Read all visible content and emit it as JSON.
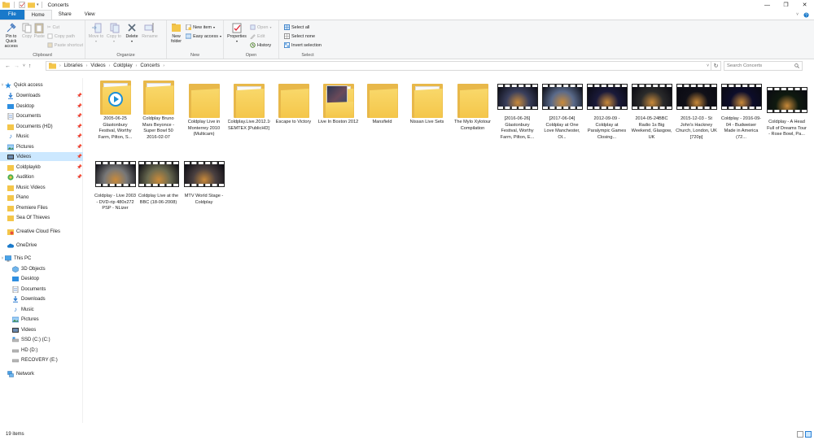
{
  "window": {
    "title": "Concerts",
    "controls": [
      "—",
      "❐",
      "✕"
    ]
  },
  "tabs": [
    {
      "label": "File"
    },
    {
      "label": "Home"
    },
    {
      "label": "Share"
    },
    {
      "label": "View"
    }
  ],
  "ribbon": {
    "clipboard": {
      "label": "Clipboard",
      "pin": "Pin to Quick access",
      "copy": "Copy",
      "paste": "Paste",
      "cut": "Cut",
      "copy_path": "Copy path",
      "paste_shortcut": "Paste shortcut"
    },
    "organize": {
      "label": "Organize",
      "move_to": "Move to",
      "copy_to": "Copy to",
      "delete": "Delete",
      "rename": "Rename"
    },
    "new": {
      "label": "New",
      "new_folder": "New folder",
      "new_item": "New item",
      "easy_access": "Easy access"
    },
    "open": {
      "label": "Open",
      "properties": "Properties",
      "open": "Open",
      "edit": "Edit",
      "history": "History"
    },
    "select": {
      "label": "Select",
      "select_all": "Select all",
      "select_none": "Select none",
      "invert": "Invert selection"
    }
  },
  "address": {
    "crumbs": [
      "Libraries",
      "Videos",
      "Coldplay",
      "Concerts"
    ],
    "search_placeholder": "Search Concerts"
  },
  "sidebar": {
    "items": [
      {
        "label": "Quick access"
      },
      {
        "label": "Downloads"
      },
      {
        "label": "Desktop"
      },
      {
        "label": "Documents"
      },
      {
        "label": "Documents (HD)"
      },
      {
        "label": "Music"
      },
      {
        "label": "Pictures"
      },
      {
        "label": "Videos"
      },
      {
        "label": "Coldplaykb"
      },
      {
        "label": "Audition"
      },
      {
        "label": "Music Videos"
      },
      {
        "label": "Piano"
      },
      {
        "label": "Premiere Files"
      },
      {
        "label": "Sea Of Thieves"
      },
      {
        "label": "Creative Cloud Files"
      },
      {
        "label": "OneDrive"
      },
      {
        "label": "This PC"
      },
      {
        "label": "3D Objects"
      },
      {
        "label": "Desktop"
      },
      {
        "label": "Documents"
      },
      {
        "label": "Downloads"
      },
      {
        "label": "Music"
      },
      {
        "label": "Pictures"
      },
      {
        "label": "Videos"
      },
      {
        "label": "SSD (C:) (C:)"
      },
      {
        "label": "HD (D:)"
      },
      {
        "label": "RECOVERY (E:)"
      },
      {
        "label": "Network"
      }
    ]
  },
  "files": [
    {
      "label": "2005-06-25 Glastonbury Festival, Worthy Farm, Pilton, S...",
      "kind": "folder-media"
    },
    {
      "label": "Coldplay Bruno Mars Beyonce - Super Bowl 50 2016-02-07",
      "kind": "folder-doc"
    },
    {
      "label": "Coldplay Live in Monterrey 2010 (Multicam)",
      "kind": "folder"
    },
    {
      "label": "Coldplay.Live.2012.1080p.BluRay.x264-SEMTEX [PublicHD]",
      "kind": "folder-doc"
    },
    {
      "label": "Escape to Victory",
      "kind": "folder"
    },
    {
      "label": "Live In Boston 2012",
      "kind": "folder-photo"
    },
    {
      "label": "Mansfield",
      "kind": "folder"
    },
    {
      "label": "Nissan Live Sets",
      "kind": "folder-doc"
    },
    {
      "label": "The Mylo Xylotour Compilation",
      "kind": "folder"
    },
    {
      "label": "[2016-06-26] Glastonbury Festival, Worthy Farm, Pilton, E...",
      "kind": "video"
    },
    {
      "label": "[2017-06-04] Coldplay at One Love Manchester, Ol...",
      "kind": "video"
    },
    {
      "label": "2012-09-09 - Coldplay at Paralympic Games Closing...",
      "kind": "video"
    },
    {
      "label": "2014-05-24BBC Radio 1s Big Weekend, Glasgow, UK",
      "kind": "video"
    },
    {
      "label": "2015-12-03 - St John's Hackney Church, London, UK [720p]",
      "kind": "video"
    },
    {
      "label": "Coldplay - 2016-09-04 - Budweiser Made in America (72...",
      "kind": "video"
    },
    {
      "label": "Coldplay - A Head Full of Dreams Tour - Rose Bowl, Pa...",
      "kind": "video"
    },
    {
      "label": "Coldplay - Live 2003 - DVD-rip 480x272 PSP - NLizer",
      "kind": "video"
    },
    {
      "label": "Coldplay Live at the BBC (18-06-2008)",
      "kind": "video"
    },
    {
      "label": "MTV World Stage - Coldplay",
      "kind": "video"
    }
  ],
  "thumb_colors": [
    "#3a3f5c",
    "#5a6a8a",
    "#1a1a3a",
    "#2b2b2b",
    "#101018",
    "#0d0d2a",
    "#0f1a0f",
    "#777777",
    "#6a6a50",
    "#4a4040"
  ],
  "status": {
    "count": "19 items"
  }
}
